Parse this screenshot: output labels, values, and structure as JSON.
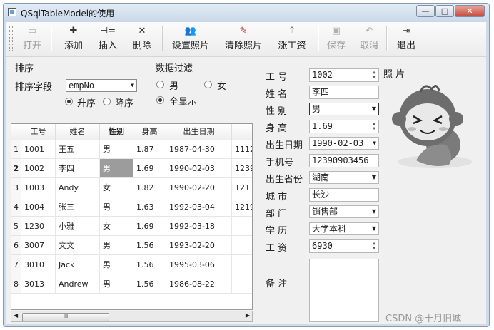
{
  "window": {
    "title": "QSqlTableModel的使用",
    "buttons": [
      "—",
      "□",
      "✕"
    ]
  },
  "toolbar": {
    "open": "打开",
    "add": "添加",
    "insert": "插入",
    "delete": "删除",
    "set_photo": "设置照片",
    "clear_photo": "清除照片",
    "raise_salary": "涨工资",
    "save": "保存",
    "cancel": "取消",
    "exit": "退出"
  },
  "sort": {
    "title": "排序",
    "field_label": "排序字段",
    "field_value": "empNo",
    "asc": "升序",
    "desc": "降序",
    "selected": "asc"
  },
  "filter": {
    "title": "数据过滤",
    "male": "男",
    "female": "女",
    "all": "全显示",
    "selected": "all"
  },
  "table": {
    "columns": [
      "工号",
      "姓名",
      "性别",
      "身高",
      "出生日期",
      ""
    ],
    "rows": [
      {
        "num": "1",
        "cells": [
          "1001",
          "王五",
          "男",
          "1.87",
          "1987-04-30",
          "1112"
        ]
      },
      {
        "num": "2",
        "cells": [
          "1002",
          "李四",
          "男",
          "1.69",
          "1990-02-03",
          "1239"
        ]
      },
      {
        "num": "3",
        "cells": [
          "1003",
          "Andy",
          "女",
          "1.82",
          "1990-02-20",
          "1213"
        ]
      },
      {
        "num": "4",
        "cells": [
          "1004",
          "张三",
          "男",
          "1.63",
          "1992-03-04",
          "1219"
        ]
      },
      {
        "num": "5",
        "cells": [
          "1230",
          "小雅",
          "女",
          "1.69",
          "1992-03-18",
          ""
        ]
      },
      {
        "num": "6",
        "cells": [
          "3007",
          "文文",
          "男",
          "1.56",
          "1993-02-20",
          ""
        ]
      },
      {
        "num": "7",
        "cells": [
          "3010",
          "Jack",
          "男",
          "1.56",
          "1995-03-06",
          ""
        ]
      },
      {
        "num": "8",
        "cells": [
          "3013",
          "Andrew",
          "男",
          "1.56",
          "1986-08-22",
          ""
        ]
      }
    ],
    "scroll_thumb": "III"
  },
  "form": {
    "empno_label": "工 号",
    "empno": "1002",
    "name_label": "姓 名",
    "name": "李四",
    "gender_label": "性 别",
    "gender": "男",
    "height_label": "身 高",
    "height": "1.69",
    "birthday_label": "出生日期",
    "birthday": "1990-02-03",
    "mobile_label": "手机号",
    "mobile": "12390903456",
    "province_label": "出生省份",
    "province": "湖南",
    "city_label": "城 市",
    "city": "长沙",
    "department_label": "部 门",
    "department": "销售部",
    "education_label": "学 历",
    "education": "大学本科",
    "salary_label": "工 资",
    "salary": "6930",
    "memo_label": "备 注",
    "photo_label": "照 片"
  },
  "watermark": "CSDN @十月旧城"
}
